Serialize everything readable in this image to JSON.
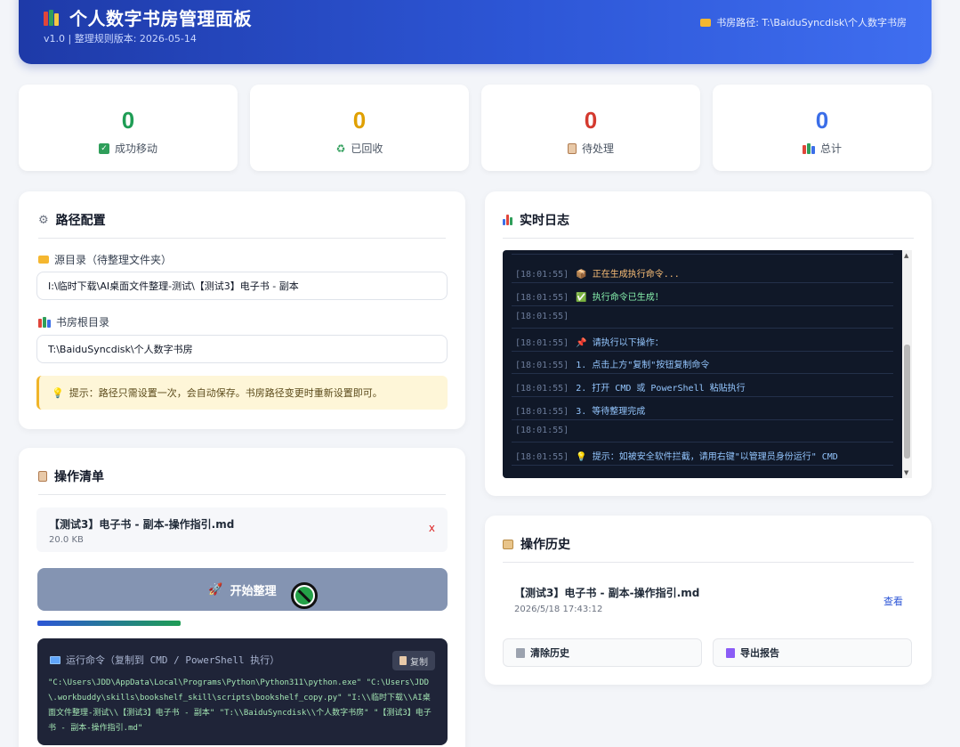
{
  "header": {
    "title": "个人数字书房管理面板",
    "version": "v1.0 | 整理规则版本: 2026-05-14",
    "path_label": "书房路径: T:\\BaiduSyncdisk\\个人数字书房"
  },
  "stats": [
    {
      "value": "0",
      "label": "成功移动",
      "color": "#1f9d55",
      "icon": "check-icon"
    },
    {
      "value": "0",
      "label": "已回收",
      "color": "#e0a000",
      "icon": "recycle-icon"
    },
    {
      "value": "0",
      "label": "待处理",
      "color": "#d43a2f",
      "icon": "clipboard-icon"
    },
    {
      "value": "0",
      "label": "总计",
      "color": "#3b6ee8",
      "icon": "books-icon"
    }
  ],
  "path_config": {
    "title": "路径配置",
    "source_label": "源目录（待整理文件夹）",
    "source_value": "I:\\临时下载\\AI桌面文件整理-测试\\【测试3】电子书 - 副本",
    "library_label": "书房根目录",
    "library_value": "T:\\BaiduSyncdisk\\个人数字书房",
    "tip": "提示：路径只需设置一次，会自动保存。书房路径变更时重新设置即可。"
  },
  "operations": {
    "title": "操作清单",
    "file_name": "【测试3】电子书 - 副本-操作指引.md",
    "file_size": "20.0 KB",
    "remove": "x",
    "start_label": "开始整理",
    "progress": 0.35,
    "cmd_title": "运行命令（复制到 CMD / PowerShell 执行）",
    "copy_label": "复制",
    "cmd_text": "\"C:\\Users\\JDD\\AppData\\Local\\Programs\\Python\\Python311\\python.exe\" \"C:\\Users\\JDD\\.workbuddy\\skills\\bookshelf_skill\\scripts\\bookshelf_copy.py\" \"I:\\\\临时下载\\\\AI桌面文件整理-测试\\\\【测试3】电子书 - 副本\" \"T:\\\\BaiduSyncdisk\\\\个人数字书房\" \"【测试3】电子书 - 副本-操作指引.md\""
  },
  "log": {
    "title": "实时日志",
    "lines": [
      {
        "time": "[18:01:55]",
        "text": "📦 正在生成执行命令...",
        "color": "#fbbf77"
      },
      {
        "time": "[18:01:55]",
        "text": "✅ 执行命令已生成！",
        "color": "#86efac"
      },
      {
        "time": "[18:01:55]",
        "text": "",
        "color": "#93c5fd"
      },
      {
        "time": "[18:01:55]",
        "text": "📌 请执行以下操作：",
        "color": "#93c5fd"
      },
      {
        "time": "[18:01:55]",
        "text": "1. 点击上方\"复制\"按钮复制命令",
        "color": "#93c5fd"
      },
      {
        "time": "[18:01:55]",
        "text": "2. 打开 CMD 或 PowerShell 粘贴执行",
        "color": "#93c5fd"
      },
      {
        "time": "[18:01:55]",
        "text": "3. 等待整理完成",
        "color": "#93c5fd"
      },
      {
        "time": "[18:01:55]",
        "text": "",
        "color": "#93c5fd"
      },
      {
        "time": "[18:01:55]",
        "text": "💡 提示：如被安全软件拦截，请用右键\"以管理员身份运行\" CMD",
        "color": "#93c5fd"
      }
    ]
  },
  "history": {
    "title": "操作历史",
    "item_name": "【测试3】电子书 - 副本-操作指引.md",
    "item_time": "2026/5/18 17:43:12",
    "view_label": "查看",
    "clear_label": "清除历史",
    "export_label": "导出报告"
  }
}
